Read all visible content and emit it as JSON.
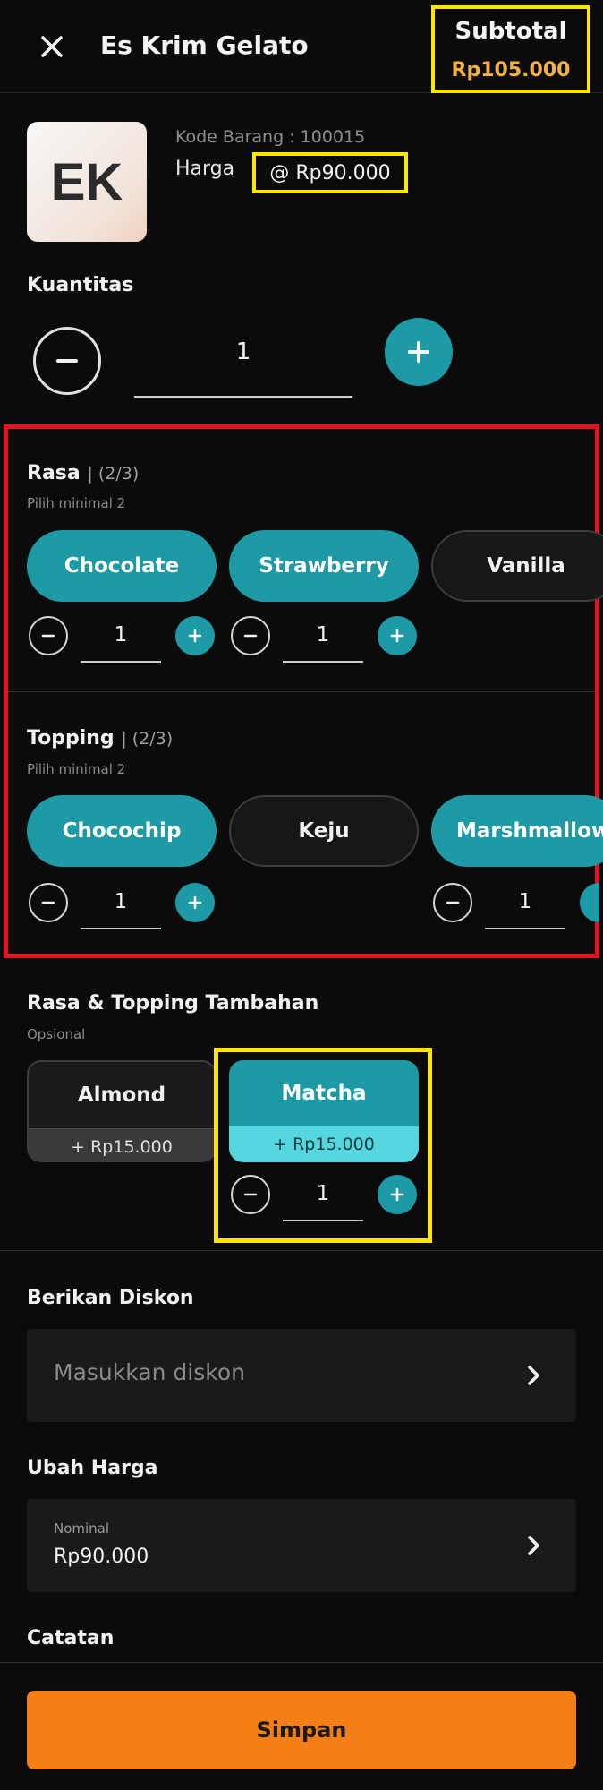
{
  "header": {
    "title": "Es Krim Gelato",
    "subtotal_label": "Subtotal",
    "subtotal_value": "Rp105.000",
    "close_icon": "close-icon"
  },
  "product": {
    "initials": "EK",
    "code_label": "Kode Barang : 100015",
    "price_label": "Harga",
    "price_value": "@ Rp90.000"
  },
  "quantity": {
    "title": "Kuantitas",
    "value": "1",
    "minus_icon": "minus-icon",
    "plus_icon": "plus-icon"
  },
  "rasa": {
    "title": "Rasa",
    "count": "| (2/3)",
    "subtitle": "Pilih minimal 2",
    "options": [
      {
        "label": "Chocolate",
        "selected": true,
        "qty": "1"
      },
      {
        "label": "Strawberry",
        "selected": true,
        "qty": "1"
      },
      {
        "label": "Vanilla",
        "selected": false
      }
    ]
  },
  "topping": {
    "title": "Topping",
    "count": "| (2/3)",
    "subtitle": "Pilih minimal 2",
    "options": [
      {
        "label": "Chocochip",
        "selected": true,
        "qty": "1"
      },
      {
        "label": "Keju",
        "selected": false
      },
      {
        "label": "Marshmallow",
        "selected": true,
        "qty": "1"
      }
    ]
  },
  "extras": {
    "title": "Rasa & Topping Tambahan",
    "subtitle": "Opsional",
    "options": [
      {
        "label": "Almond",
        "price": "+ Rp15.000",
        "selected": false
      },
      {
        "label": "Matcha",
        "price": "+ Rp15.000",
        "selected": true,
        "qty": "1"
      }
    ]
  },
  "discount": {
    "title": "Berikan Diskon",
    "placeholder": "Masukkan diskon"
  },
  "change_price": {
    "title": "Ubah Harga",
    "field_label": "Nominal",
    "value": "Rp90.000"
  },
  "notes": {
    "title": "Catatan"
  },
  "save_label": "Simpan",
  "colors": {
    "accent": "#1e9aa6",
    "button": "#f57f17",
    "subtotal": "#f3b23a",
    "highlight_yellow": "#ffe600",
    "highlight_red": "#e0161e"
  }
}
